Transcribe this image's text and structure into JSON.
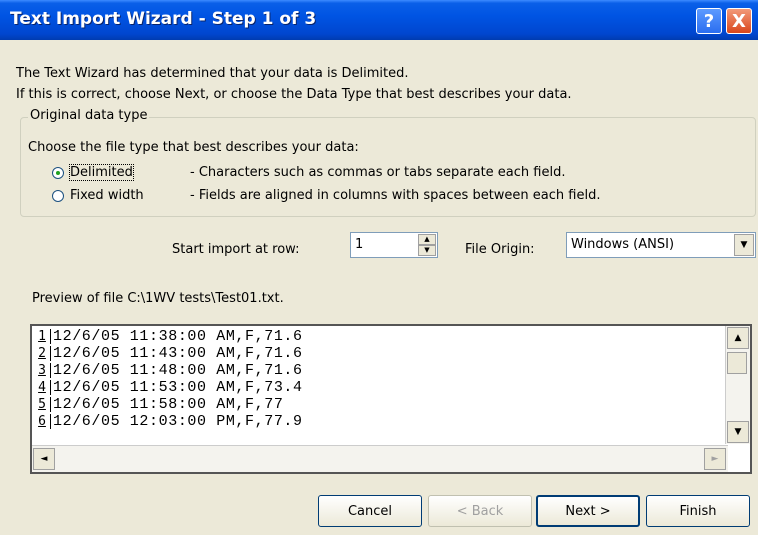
{
  "window": {
    "title": "Text Import Wizard - Step 1 of 3",
    "help_label": "?",
    "close_label": "X"
  },
  "intro": {
    "line1": "The Text Wizard has determined that your data is Delimited.",
    "line2": "If this is correct, choose Next, or choose the Data Type that best describes your data."
  },
  "original_data_type": {
    "legend": "Original data type",
    "prompt": "Choose the file type that best describes your data:",
    "options": [
      {
        "label": "Delimited",
        "description": "- Characters such as commas or tabs separate each field.",
        "selected": true
      },
      {
        "label": "Fixed width",
        "description": "- Fields are aligned in columns with spaces between each field.",
        "selected": false
      }
    ]
  },
  "start_import": {
    "label": "Start import at row:",
    "value": "1"
  },
  "file_origin": {
    "label": "File Origin:",
    "value": "Windows (ANSI)"
  },
  "preview": {
    "label": "Preview of file C:\\1WV tests\\Test01.txt.",
    "rows": [
      {
        "num": "1",
        "text": "12/6/05 11:38:00 AM,F,71.6"
      },
      {
        "num": "2",
        "text": "12/6/05 11:43:00 AM,F,71.6"
      },
      {
        "num": "3",
        "text": "12/6/05 11:48:00 AM,F,71.6"
      },
      {
        "num": "4",
        "text": "12/6/05 11:53:00 AM,F,73.4"
      },
      {
        "num": "5",
        "text": "12/6/05 11:58:00 AM,F,77"
      },
      {
        "num": "6",
        "text": "12/6/05 12:03:00 PM,F,77.9"
      }
    ]
  },
  "buttons": {
    "cancel": "Cancel",
    "back": "< Back",
    "next": "Next >",
    "finish": "Finish"
  }
}
